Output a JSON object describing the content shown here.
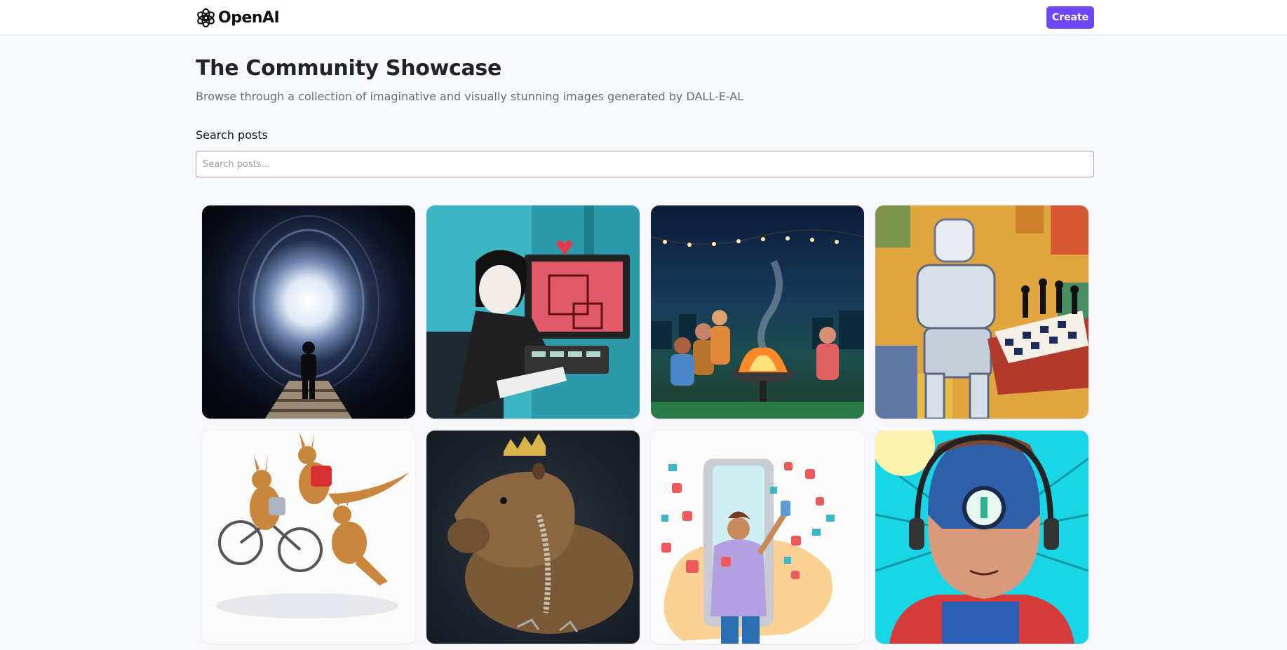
{
  "header": {
    "logo_text": "OpenAI",
    "create_label": "Create",
    "accent_color": "#6c47ff"
  },
  "main": {
    "title": "The Community Showcase",
    "subtitle": "Browse through a collection of imaginative and visually stunning images generated by DALL-E-AL"
  },
  "search": {
    "label": "Search posts",
    "placeholder": "Search posts...",
    "value": ""
  },
  "posts": [
    {
      "image": "person standing before glowing tunnel portal"
    },
    {
      "image": "illustration of person at computer with heart"
    },
    {
      "image": "friends around fire pit on rooftop at night"
    },
    {
      "image": "robot playing chess painting"
    },
    {
      "image": "kangaroos riding a bicycle"
    },
    {
      "image": "capybara wearing a crown painting"
    },
    {
      "image": "person taking selfie with social media icons"
    },
    {
      "image": "comic superhero with headphones"
    }
  ]
}
